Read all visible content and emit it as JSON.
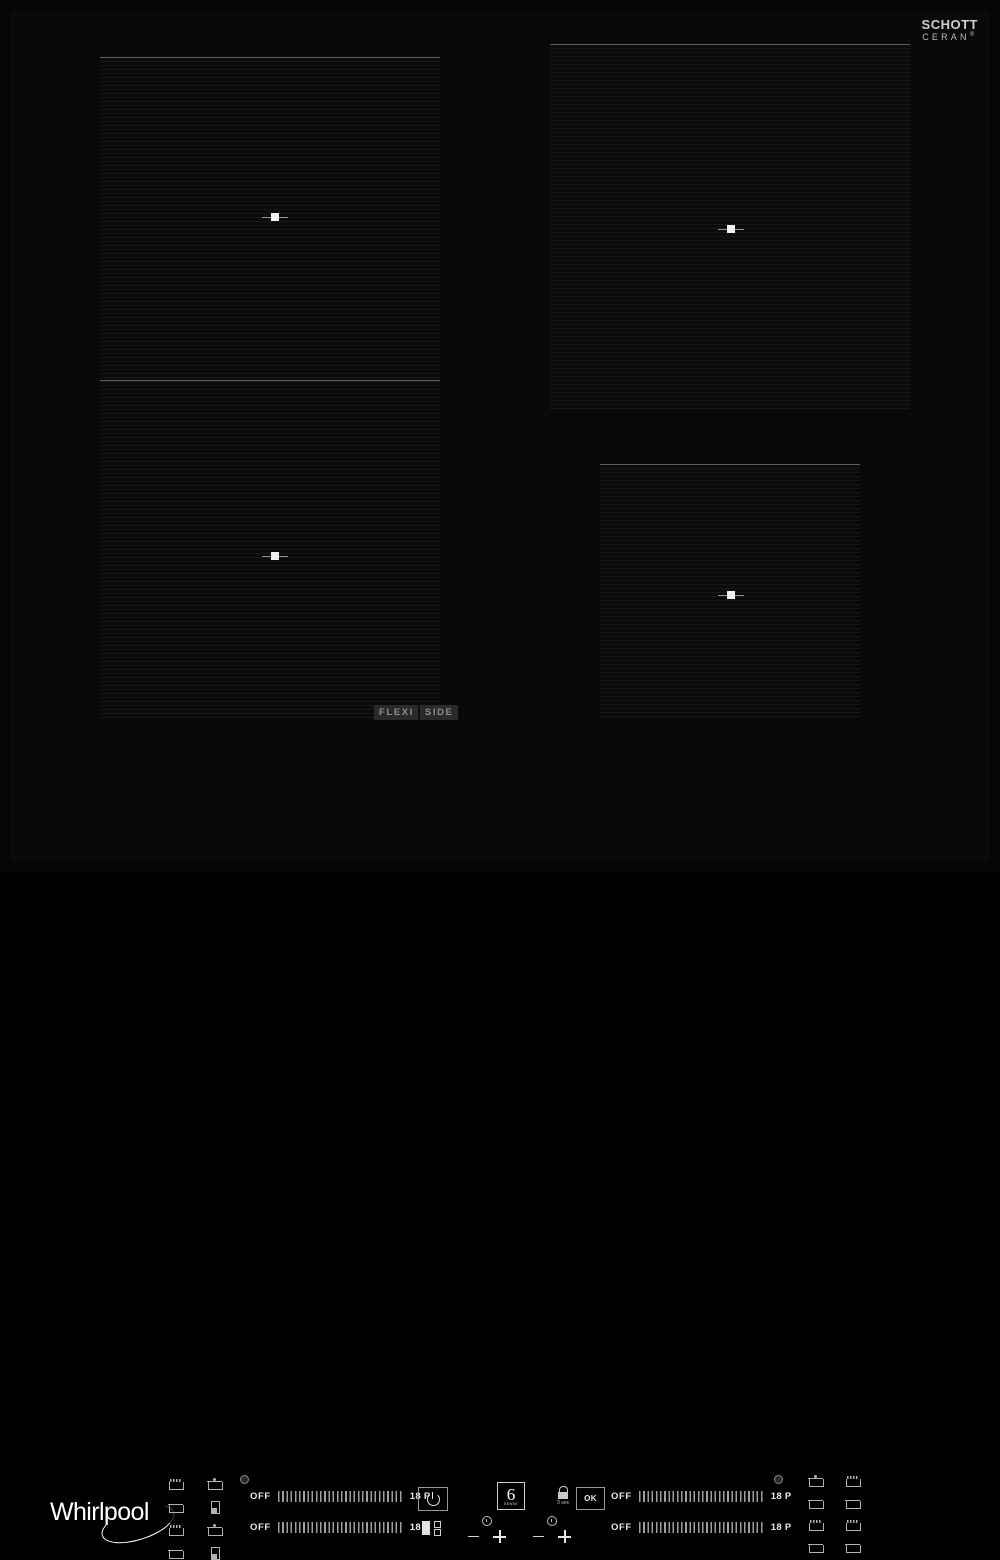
{
  "brand": {
    "name": "Whirlpool",
    "glass_logo_line1": "SCHOTT",
    "glass_logo_line2": "CERAN",
    "glass_logo_reg": "®"
  },
  "zones": {
    "flexi_label_part1": "FLEXI",
    "flexi_label_part2": "SIDE",
    "items": [
      {
        "name": "flexi-zone-upper",
        "marker": "zone-center-marker"
      },
      {
        "name": "flexi-zone-lower",
        "marker": "zone-center-marker"
      },
      {
        "name": "right-top-zone",
        "marker": "zone-center-marker"
      },
      {
        "name": "right-bottom-zone",
        "marker": "zone-center-marker"
      }
    ]
  },
  "control_panel": {
    "sliders": [
      {
        "id": "slider-left-upper",
        "off_label": "OFF",
        "max_label": "18 P",
        "value": "OFF"
      },
      {
        "id": "slider-left-lower",
        "off_label": "OFF",
        "max_label": "18 P",
        "value": "OFF"
      },
      {
        "id": "slider-right-upper",
        "off_label": "OFF",
        "max_label": "18 P",
        "value": "OFF"
      },
      {
        "id": "slider-right-lower",
        "off_label": "OFF",
        "max_label": "18 P",
        "value": "OFF"
      }
    ],
    "power_button": {
      "icon": "power-icon"
    },
    "sixth_sense_button": {
      "digit": "6",
      "caption": "SENSE"
    },
    "lock_button": {
      "icon": "lock-icon",
      "hint": "3 sec"
    },
    "ok_button": {
      "label": "OK"
    },
    "bridge_button": {
      "icon": "bridge-zone-icon"
    },
    "timers": [
      {
        "id": "timer-left",
        "icon": "clock-icon",
        "minus": "−",
        "plus": "+"
      },
      {
        "id": "timer-right",
        "icon": "clock-icon",
        "minus": "−",
        "plus": "+"
      }
    ],
    "indicators": [
      {
        "id": "led-left",
        "icon": "led-indicator-icon"
      },
      {
        "id": "led-right",
        "icon": "led-indicator-icon"
      }
    ],
    "cookware_icons_left": [
      "pan-icon",
      "pot-lid-icon",
      "pot-icon",
      "tall-pot-icon",
      "pan-icon",
      "pot-lid-icon",
      "pot-icon",
      "tall-pot-icon"
    ],
    "cookware_icons_right": [
      "pot-lid-icon",
      "pan-icon",
      "pot-icon",
      "pot-wide-icon",
      "pan-icon",
      "pan-wide-icon",
      "pot-icon",
      "pot-wide-icon"
    ]
  },
  "colors": {
    "glass": "#090909",
    "zone_line": "#ffffff",
    "text": "#e8e8e8",
    "accent": "#d9d9d9"
  }
}
